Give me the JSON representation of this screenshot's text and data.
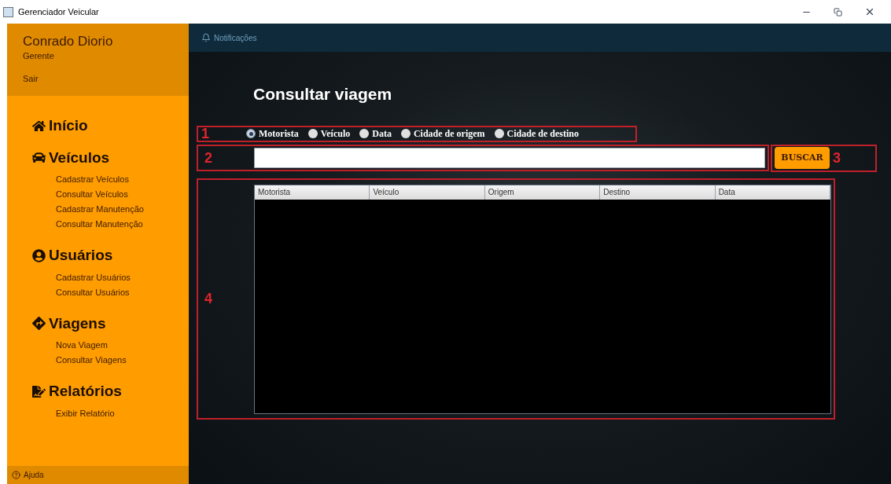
{
  "window": {
    "title": "Gerenciador Veicular"
  },
  "user": {
    "name": "Conrado Diorio",
    "role": "Gerente",
    "logout": "Sair"
  },
  "sidebar": {
    "sections": [
      {
        "title": "Início"
      },
      {
        "title": "Veículos",
        "items": [
          "Cadastrar Veículos",
          "Consultar Veículos",
          "Cadastrar Manutenção",
          "Consultar Manutenção"
        ]
      },
      {
        "title": "Usuários",
        "items": [
          "Cadastrar Usuários",
          "Consultar Usuários"
        ]
      },
      {
        "title": "Viagens",
        "items": [
          "Nova Viagem",
          "Consultar Viagens"
        ]
      },
      {
        "title": "Relatórios",
        "items": [
          "Exibir Relatório"
        ]
      }
    ],
    "help": "Ajuda"
  },
  "header": {
    "notifications": "Notificações"
  },
  "page": {
    "title": "Consultar viagem",
    "filters": [
      {
        "label": "Motorista",
        "selected": true
      },
      {
        "label": "Veículo",
        "selected": false
      },
      {
        "label": "Data",
        "selected": false
      },
      {
        "label": "Cidade de origem",
        "selected": false
      },
      {
        "label": "Cidade de destino",
        "selected": false
      }
    ],
    "search": {
      "button": "BUSCAR"
    },
    "table": {
      "columns": [
        "Motorista",
        "Veículo",
        "Origem",
        "Destino",
        "Data"
      ]
    },
    "annotations": [
      "1",
      "2",
      "3",
      "4"
    ]
  }
}
